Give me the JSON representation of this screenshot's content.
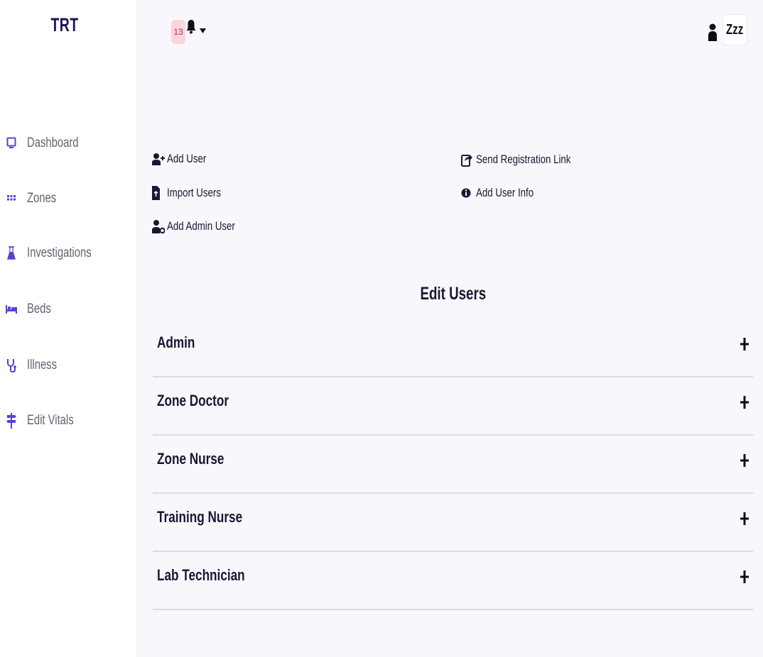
{
  "brand": "TRT",
  "sidebar": {
    "items": [
      {
        "label": "Dashboard",
        "icon": "monitor-icon"
      },
      {
        "label": "Zones",
        "icon": "grid-icon"
      },
      {
        "label": "Investigations",
        "icon": "flask-icon"
      },
      {
        "label": "Beds",
        "icon": "bed-icon"
      },
      {
        "label": "Illness",
        "icon": "stethoscope-icon"
      },
      {
        "label": "Edit Vitals",
        "icon": "signpost-icon"
      }
    ]
  },
  "topbar": {
    "notification_count": "13",
    "user_button_label": "Zzz"
  },
  "actions": [
    {
      "label": "Add User",
      "icon": "user-plus-icon"
    },
    {
      "label": "Import Users",
      "icon": "file-import-icon"
    },
    {
      "label": "Add Admin User",
      "icon": "user-shield-icon"
    },
    {
      "label": "Send Registration Link",
      "icon": "share-square-icon"
    },
    {
      "label": "Add User Info",
      "icon": "info-circle-icon"
    }
  ],
  "edit_users": {
    "title": "Edit Users",
    "groups": [
      {
        "label": "Admin"
      },
      {
        "label": "Zone Doctor"
      },
      {
        "label": "Zone Nurse"
      },
      {
        "label": "Training Nurse"
      },
      {
        "label": "Lab Technician"
      }
    ]
  },
  "colors": {
    "accent": "#5b3fd6",
    "brand_text": "#1c1454",
    "badge_bg": "#fcd5dd",
    "badge_text": "#d4264a",
    "page_bg": "#f8f7fc"
  }
}
